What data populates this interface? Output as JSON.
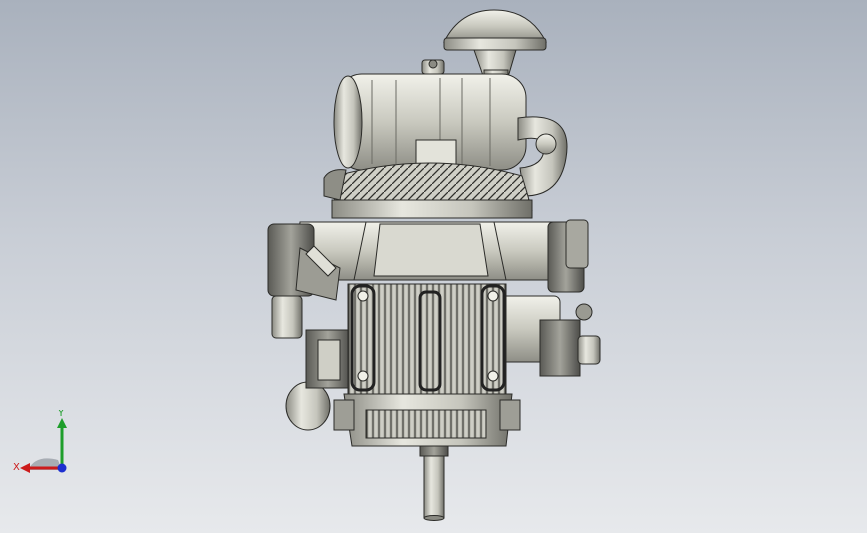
{
  "viewport": {
    "background_top": "#a9b1bd",
    "background_bottom": "#e7e9ec"
  },
  "model": {
    "icon": "engine-model"
  },
  "triad": {
    "x_label": "X",
    "y_label": "Y",
    "x_color": "#cc1b1b",
    "y_color": "#1e9e2b",
    "z_color": "#1c2fd0"
  }
}
